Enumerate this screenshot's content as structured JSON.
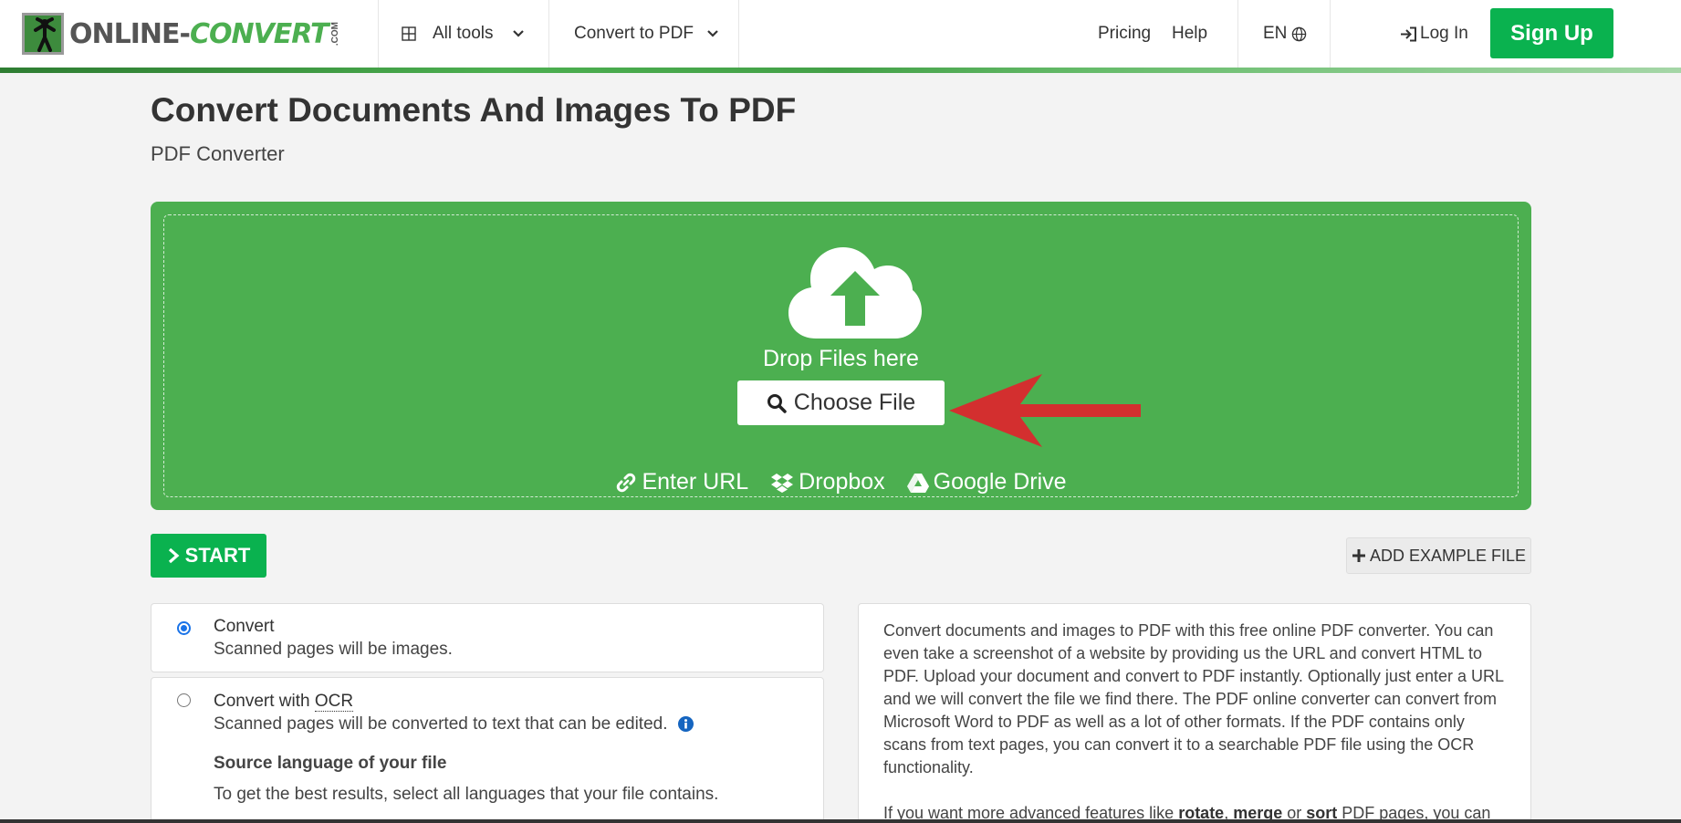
{
  "header": {
    "logo": {
      "text_main": "ONLINE-",
      "text_accent": "CONVERT",
      "text_com": ".COM"
    },
    "nav": {
      "all_tools": "All tools",
      "convert_to_pdf": "Convert to PDF",
      "pricing": "Pricing",
      "help": "Help",
      "language": "EN",
      "login": "Log In",
      "signup": "Sign Up"
    }
  },
  "page": {
    "title": "Convert Documents And Images To PDF",
    "subtitle": "PDF Converter"
  },
  "upload": {
    "drop_text": "Drop Files here",
    "choose_file": "Choose File",
    "enter_url": "Enter URL",
    "dropbox": "Dropbox",
    "google_drive": "Google Drive"
  },
  "actions": {
    "start": "START",
    "add_example": "ADD EXAMPLE FILE"
  },
  "options": {
    "convert": {
      "title": "Convert",
      "desc": "Scanned pages will be images.",
      "selected": true
    },
    "ocr": {
      "title_prefix": "Convert with ",
      "title_abbr": "OCR",
      "desc": "Scanned pages will be converted to text that can be edited.",
      "source_title": "Source language of your file",
      "source_desc": "To get the best results, select all languages that your file contains.",
      "selected": false
    }
  },
  "description": {
    "p1": "Convert documents and images to PDF with this free online PDF converter. You can even take a screenshot of a website by providing us the URL and convert HTML to PDF. Upload your document and convert to PDF instantly. Optionally just enter a URL and we will convert the file we find there. The PDF online converter can convert from Microsoft Word to PDF as well as a lot of other formats. If the PDF contains only scans from text pages, you can convert it to a searchable PDF file using the OCR functionality.",
    "p2_a": "If you want more advanced features like ",
    "p2_rotate": "rotate",
    "p2_sep1": ", ",
    "p2_merge": "merge",
    "p2_sep2": " or ",
    "p2_sort": "sort",
    "p2_b": " PDF pages, you can"
  },
  "colors": {
    "brand_green": "#4caf50",
    "button_green": "#0ab24f",
    "arrow_red": "#d32f2f",
    "radio_blue": "#1a73e8"
  }
}
